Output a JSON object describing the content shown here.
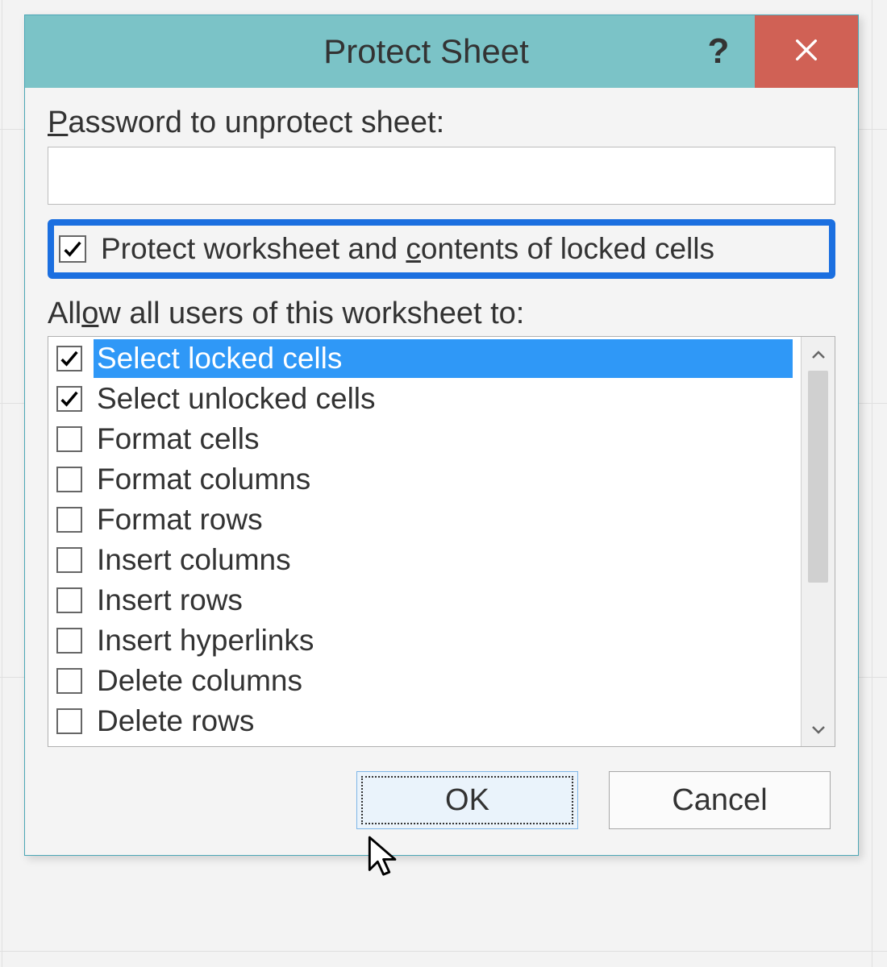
{
  "titlebar": {
    "title": "Protect Sheet",
    "help_tooltip": "?",
    "close_tooltip": "Close"
  },
  "password": {
    "label_prefix": "P",
    "label_rest": "assword to unprotect sheet:",
    "value": ""
  },
  "protect_checkbox": {
    "checked": true,
    "label_before": "Protect worksheet and ",
    "label_u": "c",
    "label_after": "ontents of locked cells"
  },
  "allow": {
    "label_before": "All",
    "label_u": "o",
    "label_after": "w all users of this worksheet to:"
  },
  "permissions": [
    {
      "label": "Select locked cells",
      "checked": true,
      "selected": true
    },
    {
      "label": "Select unlocked cells",
      "checked": true,
      "selected": false
    },
    {
      "label": "Format cells",
      "checked": false,
      "selected": false
    },
    {
      "label": "Format columns",
      "checked": false,
      "selected": false
    },
    {
      "label": "Format rows",
      "checked": false,
      "selected": false
    },
    {
      "label": "Insert columns",
      "checked": false,
      "selected": false
    },
    {
      "label": "Insert rows",
      "checked": false,
      "selected": false
    },
    {
      "label": "Insert hyperlinks",
      "checked": false,
      "selected": false
    },
    {
      "label": "Delete columns",
      "checked": false,
      "selected": false
    },
    {
      "label": "Delete rows",
      "checked": false,
      "selected": false
    }
  ],
  "buttons": {
    "ok": "OK",
    "cancel": "Cancel"
  },
  "colors": {
    "titlebar_bg": "#7bc3c7",
    "close_bg": "#d06155",
    "highlight_border": "#1b6fe0",
    "list_selection": "#2f98f7"
  }
}
